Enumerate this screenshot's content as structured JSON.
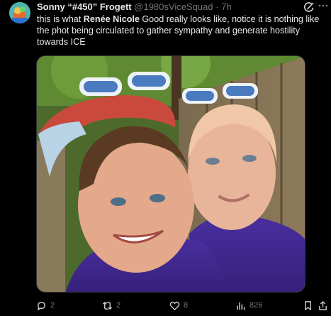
{
  "post": {
    "display_name": "Sonny “#450” Frogett",
    "handle": "@1980sViceSquad",
    "separator": "·",
    "time": "7h",
    "text_before": "this is what ",
    "text_bold": "Renée Nicole",
    "text_after": " Good really looks like, notice it is nothing like the phot being circulated to gather sympathy and generate hostility towards ICE"
  },
  "actions": {
    "replies": "2",
    "reposts": "2",
    "likes": "8",
    "views": "826"
  },
  "icons": {
    "avatar": "avatar-image",
    "grok": "grok-icon",
    "more": "more-icon",
    "reply": "reply-icon",
    "repost": "repost-icon",
    "like": "heart-icon",
    "views": "views-icon",
    "bookmark": "bookmark-icon",
    "share": "share-icon"
  },
  "colors": {
    "background": "#000000",
    "text": "#e7e9ea",
    "muted": "#71767b",
    "border": "#2f3336"
  }
}
